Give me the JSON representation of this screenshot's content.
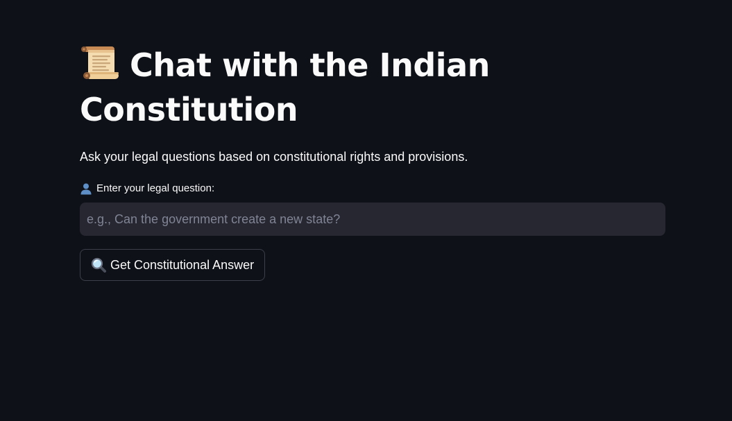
{
  "page": {
    "title_text": "Chat with the Indian Constitution",
    "subtitle": "Ask your legal questions based on constitutional rights and provisions.",
    "title_icon": "scroll-icon"
  },
  "form": {
    "label": "Enter your legal question:",
    "label_icon": "user-icon",
    "input_value": "",
    "input_placeholder": "e.g., Can the government create a new state?",
    "submit_label": "Get Constitutional Answer",
    "submit_icon": "search-icon"
  },
  "colors": {
    "background": "#0e1117",
    "input_background": "#262730",
    "text": "#fafafa",
    "placeholder": "#808495",
    "button_border": "#3d3f4a"
  }
}
